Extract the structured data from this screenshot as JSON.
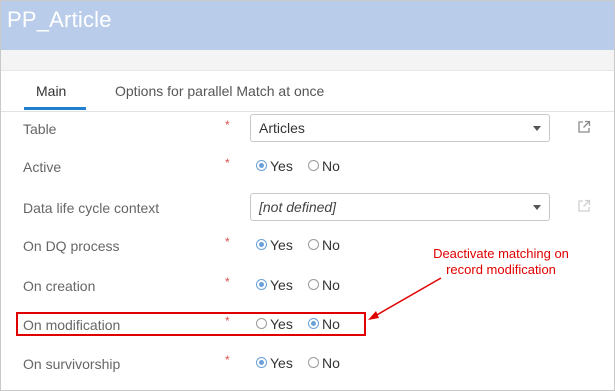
{
  "window": {
    "title": "PP_Article"
  },
  "tabs": [
    {
      "label": "Main",
      "active": true
    },
    {
      "label": "Options for parallel Match at once",
      "active": false
    }
  ],
  "fields": {
    "table": {
      "label": "Table",
      "required": "*",
      "value": "Articles"
    },
    "active": {
      "label": "Active",
      "required": "*",
      "yes": "Yes",
      "no": "No",
      "selected": "Yes"
    },
    "dlc_context": {
      "label": "Data life cycle context",
      "value": "[not defined]"
    },
    "on_dq_process": {
      "label": "On DQ process",
      "required": "*",
      "yes": "Yes",
      "no": "No",
      "selected": "Yes"
    },
    "on_creation": {
      "label": "On creation",
      "required": "*",
      "yes": "Yes",
      "no": "No",
      "selected": "Yes"
    },
    "on_modification": {
      "label": "On modification",
      "required": "*",
      "yes": "Yes",
      "no": "No",
      "selected": "No"
    },
    "on_survivorship": {
      "label": "On survivorship",
      "required": "*",
      "yes": "Yes",
      "no": "No",
      "selected": "Yes"
    }
  },
  "annotation": {
    "line1": "Deactivate matching on",
    "line2": "record modification",
    "color": "#e00000"
  },
  "colors": {
    "titlebar": "#b9cdea",
    "accent": "#1f7fd0",
    "radio_selected": "#6aa0d8"
  },
  "icons": {
    "open_link": "external-link-icon",
    "dropdown": "chevron-down-icon"
  }
}
